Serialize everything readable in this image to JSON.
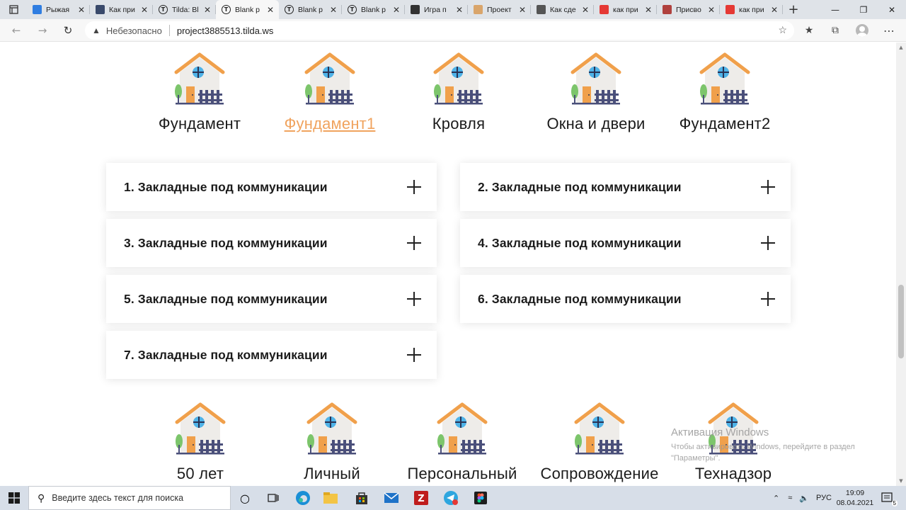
{
  "browser": {
    "tabs": [
      {
        "title": "Рыжая",
        "icon": "chat-favicon",
        "color": "#2f7de1"
      },
      {
        "title": "Как при",
        "icon": "app-favicon",
        "color": "#3a4a6b"
      },
      {
        "title": "Tilda: Bl",
        "icon": "tilda-favicon",
        "color": "#222222"
      },
      {
        "title": "Blank p",
        "icon": "tilda-favicon",
        "color": "#222222",
        "active": true
      },
      {
        "title": "Blank p",
        "icon": "tilda-favicon",
        "color": "#222222"
      },
      {
        "title": "Blank p",
        "icon": "tilda-favicon",
        "color": "#222222"
      },
      {
        "title": "Игра п",
        "icon": "game-favicon",
        "color": "#333333"
      },
      {
        "title": "Проект",
        "icon": "project-favicon",
        "color": "#d9a56b"
      },
      {
        "title": "Как сде",
        "icon": "n-favicon",
        "color": "#555555"
      },
      {
        "title": "как при",
        "icon": "yandex-favicon",
        "color": "#e53935"
      },
      {
        "title": "Присво",
        "icon": "r-favicon",
        "color": "#b0413e"
      },
      {
        "title": "как при",
        "icon": "yandex-favicon",
        "color": "#e53935"
      }
    ],
    "url_warning": "Небезопасно",
    "url": "project3885513.tilda.ws"
  },
  "page": {
    "top_categories": [
      "Фундамент",
      "Фундамент1",
      "Кровля",
      "Окна и двери",
      "Фундамент2"
    ],
    "accordion": [
      "1. Закладные под коммуникации",
      "2. Закладные под коммуникации",
      "3. Закладные под коммуникации",
      "4. Закладные под коммуникации",
      "5. Закладные под коммуникации",
      "6. Закладные под коммуникации",
      "7. Закладные под коммуникации"
    ],
    "bottom_categories": [
      "50 лет",
      "Личный",
      "Персональный",
      "Сопровождение",
      "Технадзор"
    ],
    "colors": {
      "accent_link": "#f0a35e",
      "roof": "#f0a04b",
      "window": "#4fb3e8",
      "door": "#f0a04b",
      "fence": "#4a4f7a",
      "tree": "#7cc56b"
    }
  },
  "watermark": {
    "title": "Активация Windows",
    "text": "Чтобы активировать Windows, перейдите в раздел \"Параметры\"."
  },
  "taskbar": {
    "search_placeholder": "Введите здесь текст для поиска",
    "lang": "РУС",
    "time": "19:09",
    "date": "08.04.2021",
    "notifications": "5"
  }
}
